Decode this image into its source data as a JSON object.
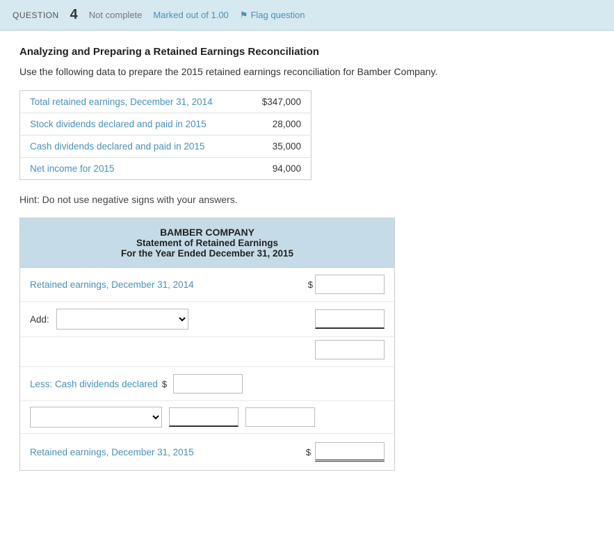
{
  "topbar": {
    "question_label": "QUESTION",
    "question_number": "4",
    "status": "Not complete",
    "marked_out": "Marked out of 1.00",
    "flag_label": "Flag question"
  },
  "question": {
    "title": "Analyzing and Preparing a Retained Earnings Reconciliation",
    "body": "Use the following data to prepare the 2015 retained earnings reconciliation for Bamber Company."
  },
  "data_table": {
    "rows": [
      {
        "label": "Total retained earnings, December 31, 2014",
        "value": "$347,000"
      },
      {
        "label": "Stock dividends declared and paid in 2015",
        "value": "28,000"
      },
      {
        "label": "Cash dividends declared and paid in 2015",
        "value": "35,000"
      },
      {
        "label": "Net income for 2015",
        "value": "94,000"
      }
    ]
  },
  "hint": "Hint: Do not use negative signs with your answers.",
  "statement": {
    "company": "BAMBER COMPANY",
    "title": "Statement of Retained Earnings",
    "period": "For the Year Ended December 31, 2015",
    "rows": {
      "retained_2014_label": "Retained earnings, December 31, 2014",
      "add_label": "Add:",
      "less_label": "Less: Cash dividends declared",
      "retained_2015_label": "Retained earnings, December 31, 2015"
    }
  }
}
